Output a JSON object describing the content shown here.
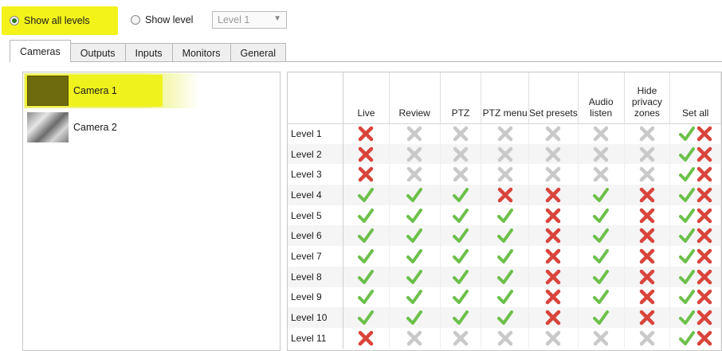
{
  "top": {
    "show_all_label": "Show all levels",
    "show_level_label": "Show level",
    "level_combo_value": "Level 1",
    "show_all_selected": true
  },
  "tabs": [
    {
      "label": "Cameras",
      "active": true
    },
    {
      "label": "Outputs",
      "active": false
    },
    {
      "label": "Inputs",
      "active": false
    },
    {
      "label": "Monitors",
      "active": false
    },
    {
      "label": "General",
      "active": false
    }
  ],
  "cameras": [
    {
      "label": "Camera 1",
      "selected": true
    },
    {
      "label": "Camera 2",
      "selected": false
    }
  ],
  "grid": {
    "columns": [
      {
        "label": "Live"
      },
      {
        "label": "Review"
      },
      {
        "label": "PTZ"
      },
      {
        "label": "PTZ menu"
      },
      {
        "label": "Set presets"
      },
      {
        "label": "Audio listen"
      },
      {
        "label": "Hide privacy zones"
      },
      {
        "label": "Set all"
      }
    ],
    "rows": [
      {
        "label": "Level 1",
        "cells": [
          "deny",
          "off",
          "off",
          "off",
          "off",
          "off",
          "off"
        ]
      },
      {
        "label": "Level 2",
        "cells": [
          "deny",
          "off",
          "off",
          "off",
          "off",
          "off",
          "off"
        ]
      },
      {
        "label": "Level 3",
        "cells": [
          "deny",
          "off",
          "off",
          "off",
          "off",
          "off",
          "off"
        ]
      },
      {
        "label": "Level 4",
        "cells": [
          "allow",
          "allow",
          "allow",
          "deny",
          "deny",
          "allow",
          "deny"
        ]
      },
      {
        "label": "Level 5",
        "cells": [
          "allow",
          "allow",
          "allow",
          "allow",
          "deny",
          "allow",
          "deny"
        ]
      },
      {
        "label": "Level 6",
        "cells": [
          "allow",
          "allow",
          "allow",
          "allow",
          "deny",
          "allow",
          "deny"
        ]
      },
      {
        "label": "Level 7",
        "cells": [
          "allow",
          "allow",
          "allow",
          "allow",
          "deny",
          "allow",
          "deny"
        ]
      },
      {
        "label": "Level 8",
        "cells": [
          "allow",
          "allow",
          "allow",
          "allow",
          "deny",
          "allow",
          "deny"
        ]
      },
      {
        "label": "Level 9",
        "cells": [
          "allow",
          "allow",
          "allow",
          "allow",
          "deny",
          "allow",
          "deny"
        ]
      },
      {
        "label": "Level 10",
        "cells": [
          "allow",
          "allow",
          "allow",
          "allow",
          "deny",
          "allow",
          "deny"
        ]
      },
      {
        "label": "Level 11",
        "cells": [
          "deny",
          "off",
          "off",
          "off",
          "off",
          "off",
          "off"
        ]
      }
    ]
  },
  "icons": {
    "allow": "check-icon",
    "deny": "cross-icon",
    "off": "cross-disabled-icon"
  },
  "colors": {
    "highlight": "#f3f31a",
    "check": "#6cc04a",
    "cross": "#d9443b",
    "disabled": "#c9c9c9"
  }
}
